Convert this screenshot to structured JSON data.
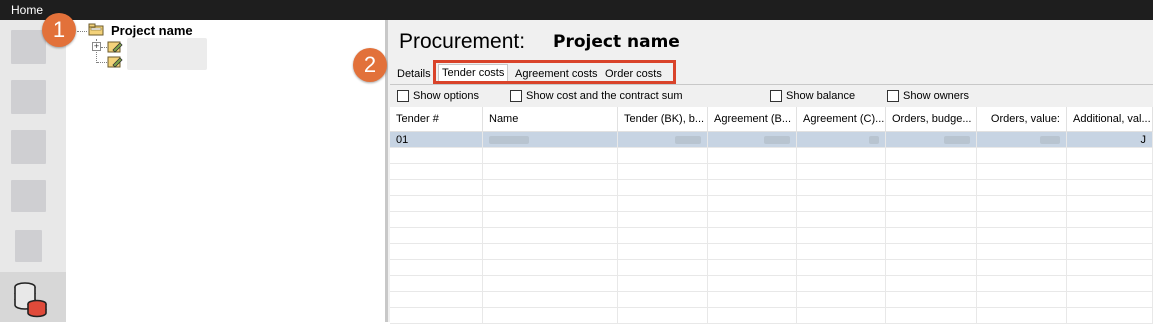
{
  "topbar": {
    "home_label": "Home"
  },
  "tree": {
    "root_label": "Project name"
  },
  "badges": {
    "first": "1",
    "second": "2"
  },
  "header": {
    "title_prefix": "Procurement:",
    "project_name": "Project name"
  },
  "tabs": [
    {
      "label": "Details"
    },
    {
      "label": "Tender costs"
    },
    {
      "label": "Agreement costs"
    },
    {
      "label": "Order costs"
    }
  ],
  "options": [
    {
      "label": "Show options",
      "checked": false
    },
    {
      "label": "Show cost and the contract sum",
      "checked": false
    },
    {
      "label": "Show balance",
      "checked": false
    },
    {
      "label": "Show owners",
      "checked": false
    }
  ],
  "grid": {
    "columns": [
      "Tender #",
      "Name",
      "Tender (BK), b...",
      "Agreement (B...",
      "Agreement (C)...",
      "Orders, budge...",
      "Orders, value:",
      "Additional, val..."
    ],
    "rows": [
      {
        "tender_no": "01",
        "last": "J"
      }
    ]
  },
  "colors": {
    "accent_badge": "#e2713a",
    "highlight_border": "#d9432a",
    "selected_row": "#c7d4e3"
  }
}
